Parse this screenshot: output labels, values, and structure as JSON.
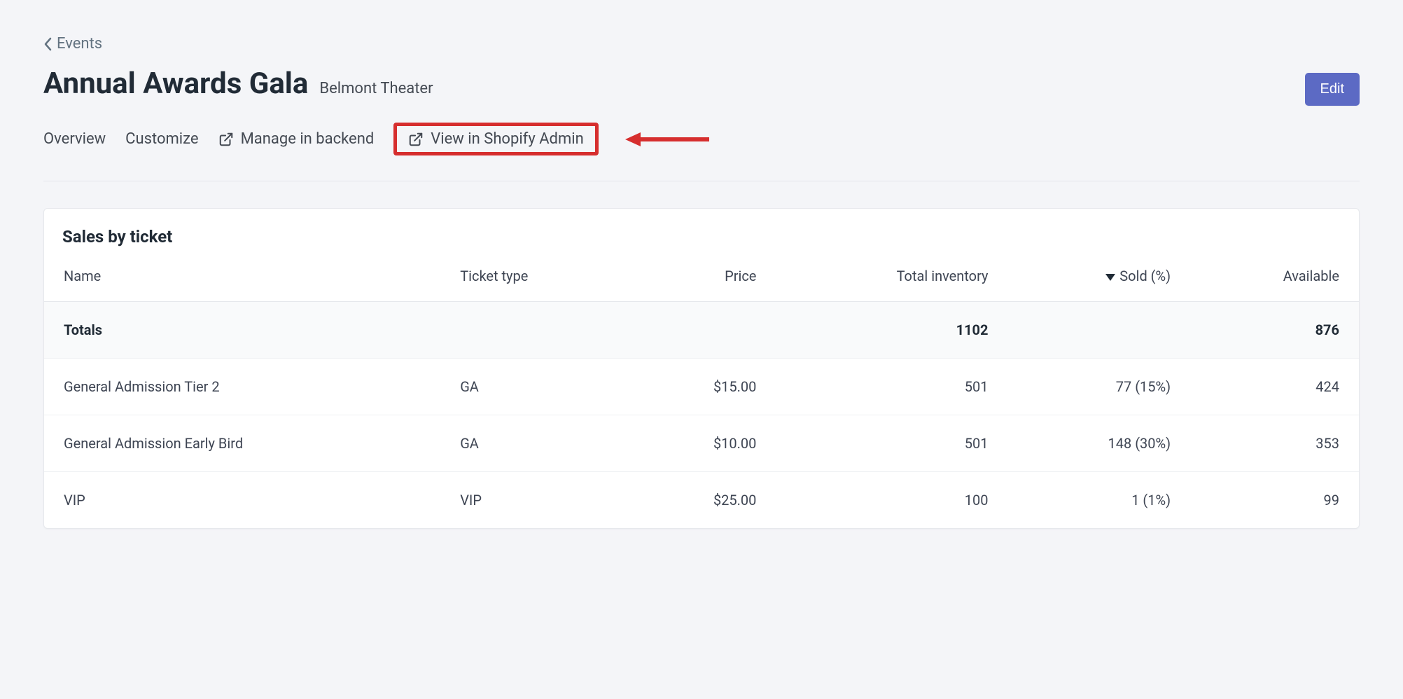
{
  "breadcrumb": {
    "label": "Events"
  },
  "header": {
    "title": "Annual Awards Gala",
    "subtitle": "Belmont Theater",
    "edit_label": "Edit"
  },
  "tabs": {
    "overview": "Overview",
    "customize": "Customize",
    "manage_backend": "Manage in backend",
    "view_shopify": "View in Shopify Admin"
  },
  "card": {
    "title": "Sales by ticket",
    "columns": {
      "name": "Name",
      "ticket_type": "Ticket type",
      "price": "Price",
      "total_inventory": "Total inventory",
      "sold": "Sold (%)",
      "available": "Available"
    },
    "totals": {
      "label": "Totals",
      "total_inventory": "1102",
      "available": "876"
    },
    "rows": [
      {
        "name": "General Admission Tier 2",
        "ticket_type": "GA",
        "price": "$15.00",
        "total_inventory": "501",
        "sold": "77 (15%)",
        "available": "424"
      },
      {
        "name": "General Admission Early Bird",
        "ticket_type": "GA",
        "price": "$10.00",
        "total_inventory": "501",
        "sold": "148 (30%)",
        "available": "353"
      },
      {
        "name": "VIP",
        "ticket_type": "VIP",
        "price": "$25.00",
        "total_inventory": "100",
        "sold": "1 (1%)",
        "available": "99"
      }
    ]
  }
}
